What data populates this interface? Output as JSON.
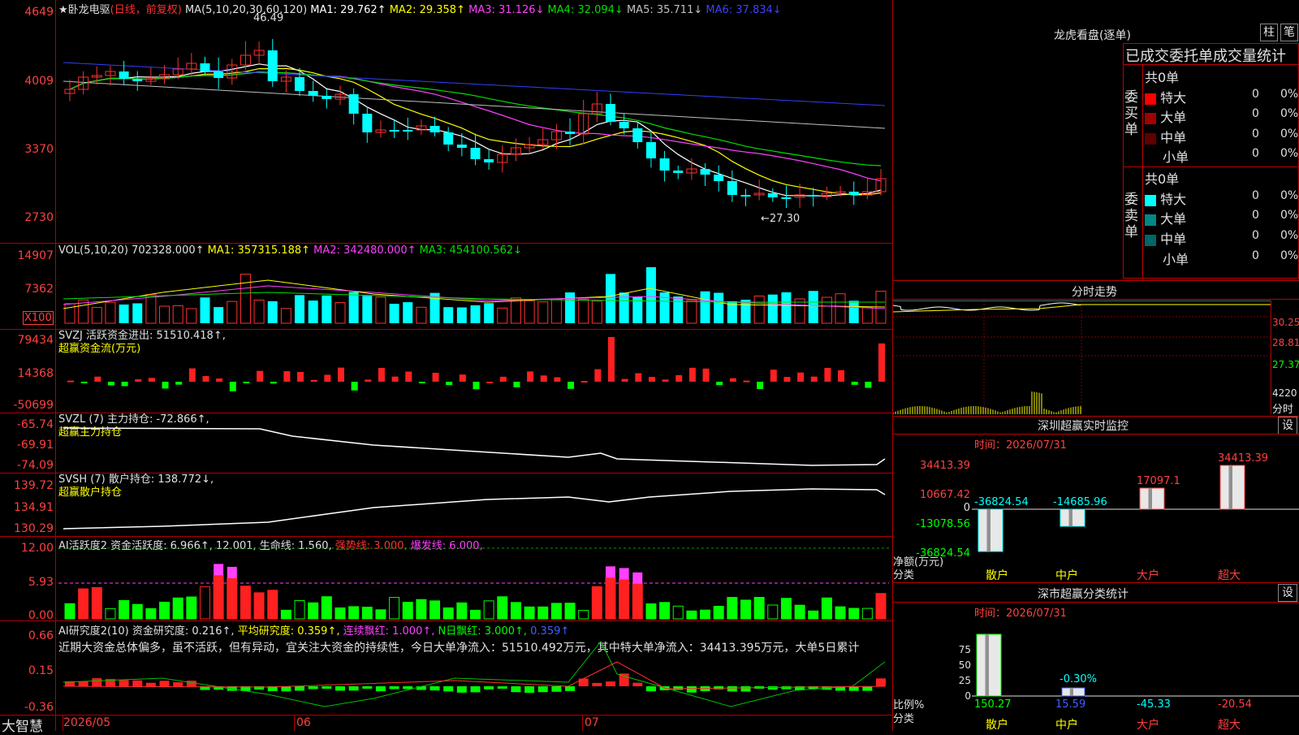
{
  "stock": {
    "star": "★",
    "name": "卧龙电驱",
    "period": "(日线，前复权)"
  },
  "main_pane": {
    "ma_label": "MA(5,10,20,30,60,120)",
    "ma1": "MA1: 29.762↑",
    "ma2": "MA2: 29.358↑",
    "ma3": "MA3: 31.126↓",
    "ma4": "MA4: 32.094↓",
    "ma5": "MA5: 35.711↓",
    "ma6": "MA6: 37.834↓",
    "high_mark": "46.49",
    "low_mark": "←27.30",
    "y_ticks": [
      "4649",
      "4009",
      "3370",
      "2730"
    ]
  },
  "vol_pane": {
    "label": "VOL(5,10,20)",
    "val": "702328.000↑",
    "ma1": "MA1: 357315.188↑",
    "ma2": "MA2: 342480.000↑",
    "ma3": "MA3: 454100.562↓",
    "y_ticks": [
      "14907",
      "7362",
      "X100"
    ]
  },
  "svzj_pane": {
    "label": "SVZJ  活跃资金进出: 51510.418↑,",
    "sub": "超赢资金流(万元)",
    "y_ticks": [
      "79434",
      "14368",
      "-50699"
    ]
  },
  "svzl_pane": {
    "label": "SVZL (7) 主力持仓: -72.866↑,",
    "sub": "超赢主力持仓",
    "y_ticks": [
      "-65.74",
      "-69.91",
      "-74.09"
    ]
  },
  "svsh_pane": {
    "label": "SVSH (7) 散户持仓: 138.772↓,",
    "sub": "超赢散户持仓",
    "y_ticks": [
      "139.72",
      "134.91",
      "130.29"
    ]
  },
  "ai2_pane": {
    "label": "AI活跃度2 资金活跃度: 6.966↑, 12.001, 生命线: 1.560,",
    "strong": "强势线: 3.000,",
    "burst": "爆发线: 6.000,",
    "y_ticks": [
      "12.00",
      "5.93",
      "0.00"
    ]
  },
  "research_pane": {
    "label": "AI研究度2(10) 资金研究度: 0.216↑,",
    "avg": "平均研究度: 0.359↑,",
    "cont": "连续飘红: 1.000↑,",
    "nday": "N日飘红: 3.000↑,",
    "last": "0.359↑",
    "comment": "近期大资金总体偏多，虽不活跃，但有异动，宜关注大资金的持续性，今日大单净流入：51510.492万元，其中特大单净流入：34413.395万元，大单5日累计",
    "y_ticks": [
      "0.66",
      "0.15",
      "-0.36"
    ]
  },
  "bottom_axis": {
    "brand": "大智慧",
    "months": [
      "2026/05",
      "06",
      "07"
    ]
  },
  "dragon_tiger": {
    "title": "龙虎看盘(逐单)",
    "btn1": "柱",
    "btn2": "笔",
    "header": "已成交委托单成交量统计",
    "buy": {
      "label": "委买单",
      "total": "共0单",
      "rows": [
        {
          "name": "特大",
          "v": "0",
          "p": "0%"
        },
        {
          "name": "大单",
          "v": "0",
          "p": "0%"
        },
        {
          "name": "中单",
          "v": "0",
          "p": "0%"
        },
        {
          "name": "小单",
          "v": "0",
          "p": "0%"
        }
      ]
    },
    "sell": {
      "label": "委卖单",
      "total": "共0单",
      "rows": [
        {
          "name": "特大",
          "v": "0",
          "p": "0%"
        },
        {
          "name": "大单",
          "v": "0",
          "p": "0%"
        },
        {
          "name": "中单",
          "v": "0",
          "p": "0%"
        },
        {
          "name": "小单",
          "v": "0",
          "p": "0%"
        }
      ]
    }
  },
  "minute": {
    "title": "分时走势",
    "prices": [
      "30.25",
      "28.81",
      "27.37"
    ],
    "vol": "4220",
    "unit": "分时"
  },
  "sz_monitor": {
    "title": "深圳超赢实时监控",
    "btn": "设",
    "time": "时间：2026/07/31",
    "y_ticks": [
      "34413.39",
      "10667.42",
      "0",
      "-13078.56",
      "-36824.54"
    ],
    "y_label": "净额(万元)",
    "x_label": "分类",
    "cats": [
      "散户",
      "中户",
      "大户",
      "超大"
    ],
    "vals": [
      "-36824.54",
      "-14685.96",
      "17097.1",
      "34413.39"
    ]
  },
  "sz_class": {
    "title": "深市超赢分类统计",
    "btn": "设",
    "time": "时间：2026/07/31",
    "y_ticks": [
      "75",
      "50",
      "25",
      "0"
    ],
    "y_label": "比例%",
    "x_label": "分类",
    "cats": [
      "散户",
      "中户",
      "大户",
      "超大"
    ],
    "vals": [
      "150.27",
      "15.59",
      "-45.33",
      "-20.54"
    ],
    "mid_label": "-0.30%"
  }
}
